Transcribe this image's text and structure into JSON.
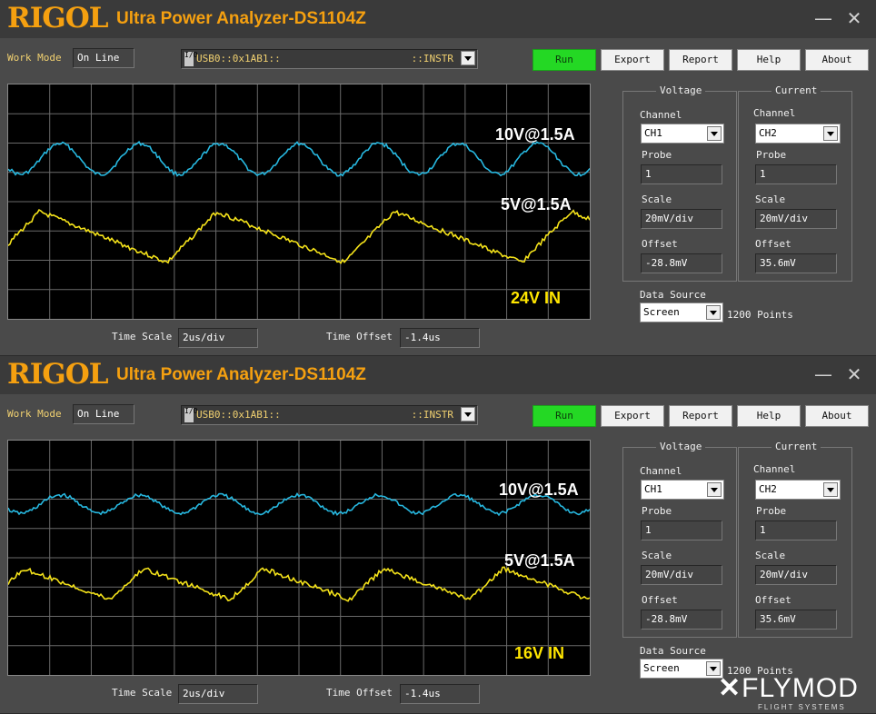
{
  "brand": "RIGOL",
  "app_title": "Ultra Power Analyzer-DS1104Z",
  "window": {
    "minimize": "—",
    "close": "✕"
  },
  "work_mode_label": "Work Mode",
  "work_mode_value": "On Line",
  "usb": {
    "io": "I/O",
    "device": "USB0::0x1AB1::",
    "suffix": "::INSTR"
  },
  "buttons": {
    "run": "Run",
    "export": "Export",
    "report": "Report",
    "help": "Help",
    "about": "About"
  },
  "voltage": {
    "title": "Voltage",
    "channel_label": "Channel",
    "channel": "CH1",
    "probe_label": "Probe",
    "probe": "1",
    "scale_label": "Scale",
    "scale": "20mV/div",
    "offset_label": "Offset",
    "offset": "-28.8mV"
  },
  "current": {
    "title": "Current",
    "channel_label": "Channel",
    "channel": "CH2",
    "probe_label": "Probe",
    "probe": "1",
    "scale_label": "Scale",
    "scale": "20mV/div",
    "offset_label": "Offset",
    "offset": "35.6mV"
  },
  "data_source": {
    "label": "Data Source",
    "value": "Screen",
    "points": "1200 Points"
  },
  "time_scale": {
    "label": "Time Scale",
    "value": "2us/div"
  },
  "time_offset": {
    "label": "Time Offset",
    "value": "-1.4us"
  },
  "panels": [
    {
      "blue_label": "10V@1.5A",
      "yellow_label": "5V@1.5A",
      "input_label": "24V IN"
    },
    {
      "blue_label": "10V@1.5A",
      "yellow_label": "5V@1.5A",
      "input_label": "16V IN"
    }
  ],
  "watermark": {
    "text": "FLYMOD",
    "sub": "FLIGHT SYSTEMS"
  },
  "colors": {
    "blue_trace": "#27b8e0",
    "yellow_trace": "#f4e21a",
    "run_button": "#24d824",
    "brand": "#f5a010"
  }
}
